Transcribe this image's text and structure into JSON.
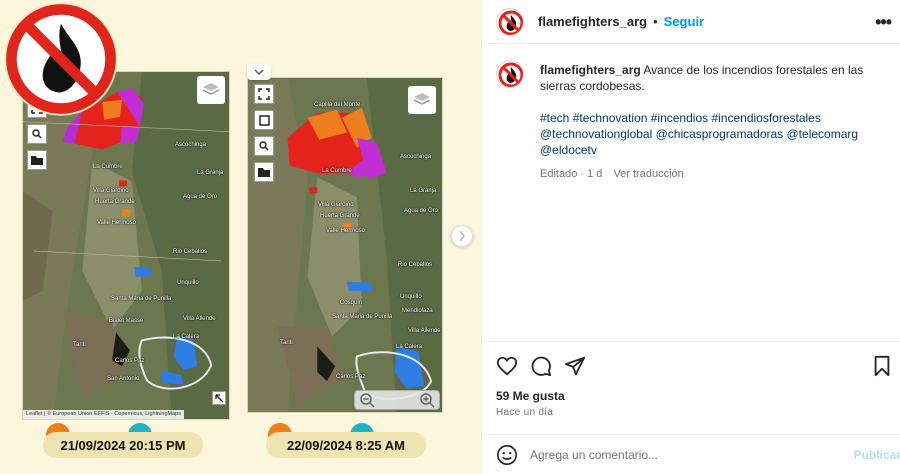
{
  "media": {
    "captions": [
      "21/09/2024 20:15 PM",
      "22/09/2024 8:25 AM"
    ],
    "map1": {
      "places": [
        "Ascochinga",
        "La Cumbre",
        "La Granja",
        "Villa Giardino",
        "Huerta Grande",
        "Agua de Oro",
        "Valle Hermoso",
        "Rio Ceballos",
        "Unquillo",
        "Santa Maria de Punilla",
        "Villa Allende",
        "Bialet Masse",
        "Tanti",
        "La Calera",
        "Carlos Paz",
        "San Antonio"
      ],
      "attribution": "Leaflet | © European Union EFFIS · Copernicus, LightningMaps"
    },
    "map2": {
      "places": [
        "Capilla del Monte",
        "Ascochinga",
        "La Cumbre",
        "La Granja",
        "Villa Giardino",
        "Huerta Grande",
        "Agua de Oro",
        "Valle Hermoso",
        "Rio Ceballos",
        "Unquillo",
        "Cosquin",
        "Santa Maria de Punilla",
        "Mendiolaza",
        "Villa Allende",
        "Tanti",
        "La Calera",
        "Carlos Paz"
      ]
    }
  },
  "post": {
    "username": "flamefighters_arg",
    "separator": "•",
    "follow_label": "Seguir",
    "more_label": "•••",
    "caption_text": "Avance de los incendios forestales en las sierras cordobesas.",
    "hashtags": "#tech #technovation #incendios #incendiosforestales @technovationglobal @chicasprogramadoras @telecomarg @eldocetv",
    "edited": "Editado · 1 d",
    "see_translation": "Ver traducción",
    "likes": "59 Me gusta",
    "date": "Hace un día",
    "comment_placeholder": "Agrega un comentario...",
    "post_label": "Publicar"
  },
  "colors": {
    "accent_blue": "#0095f6",
    "post_disabled": "#b2dffc",
    "caption_pill": "#efe3b2",
    "media_bg": "#fbf6dc"
  }
}
